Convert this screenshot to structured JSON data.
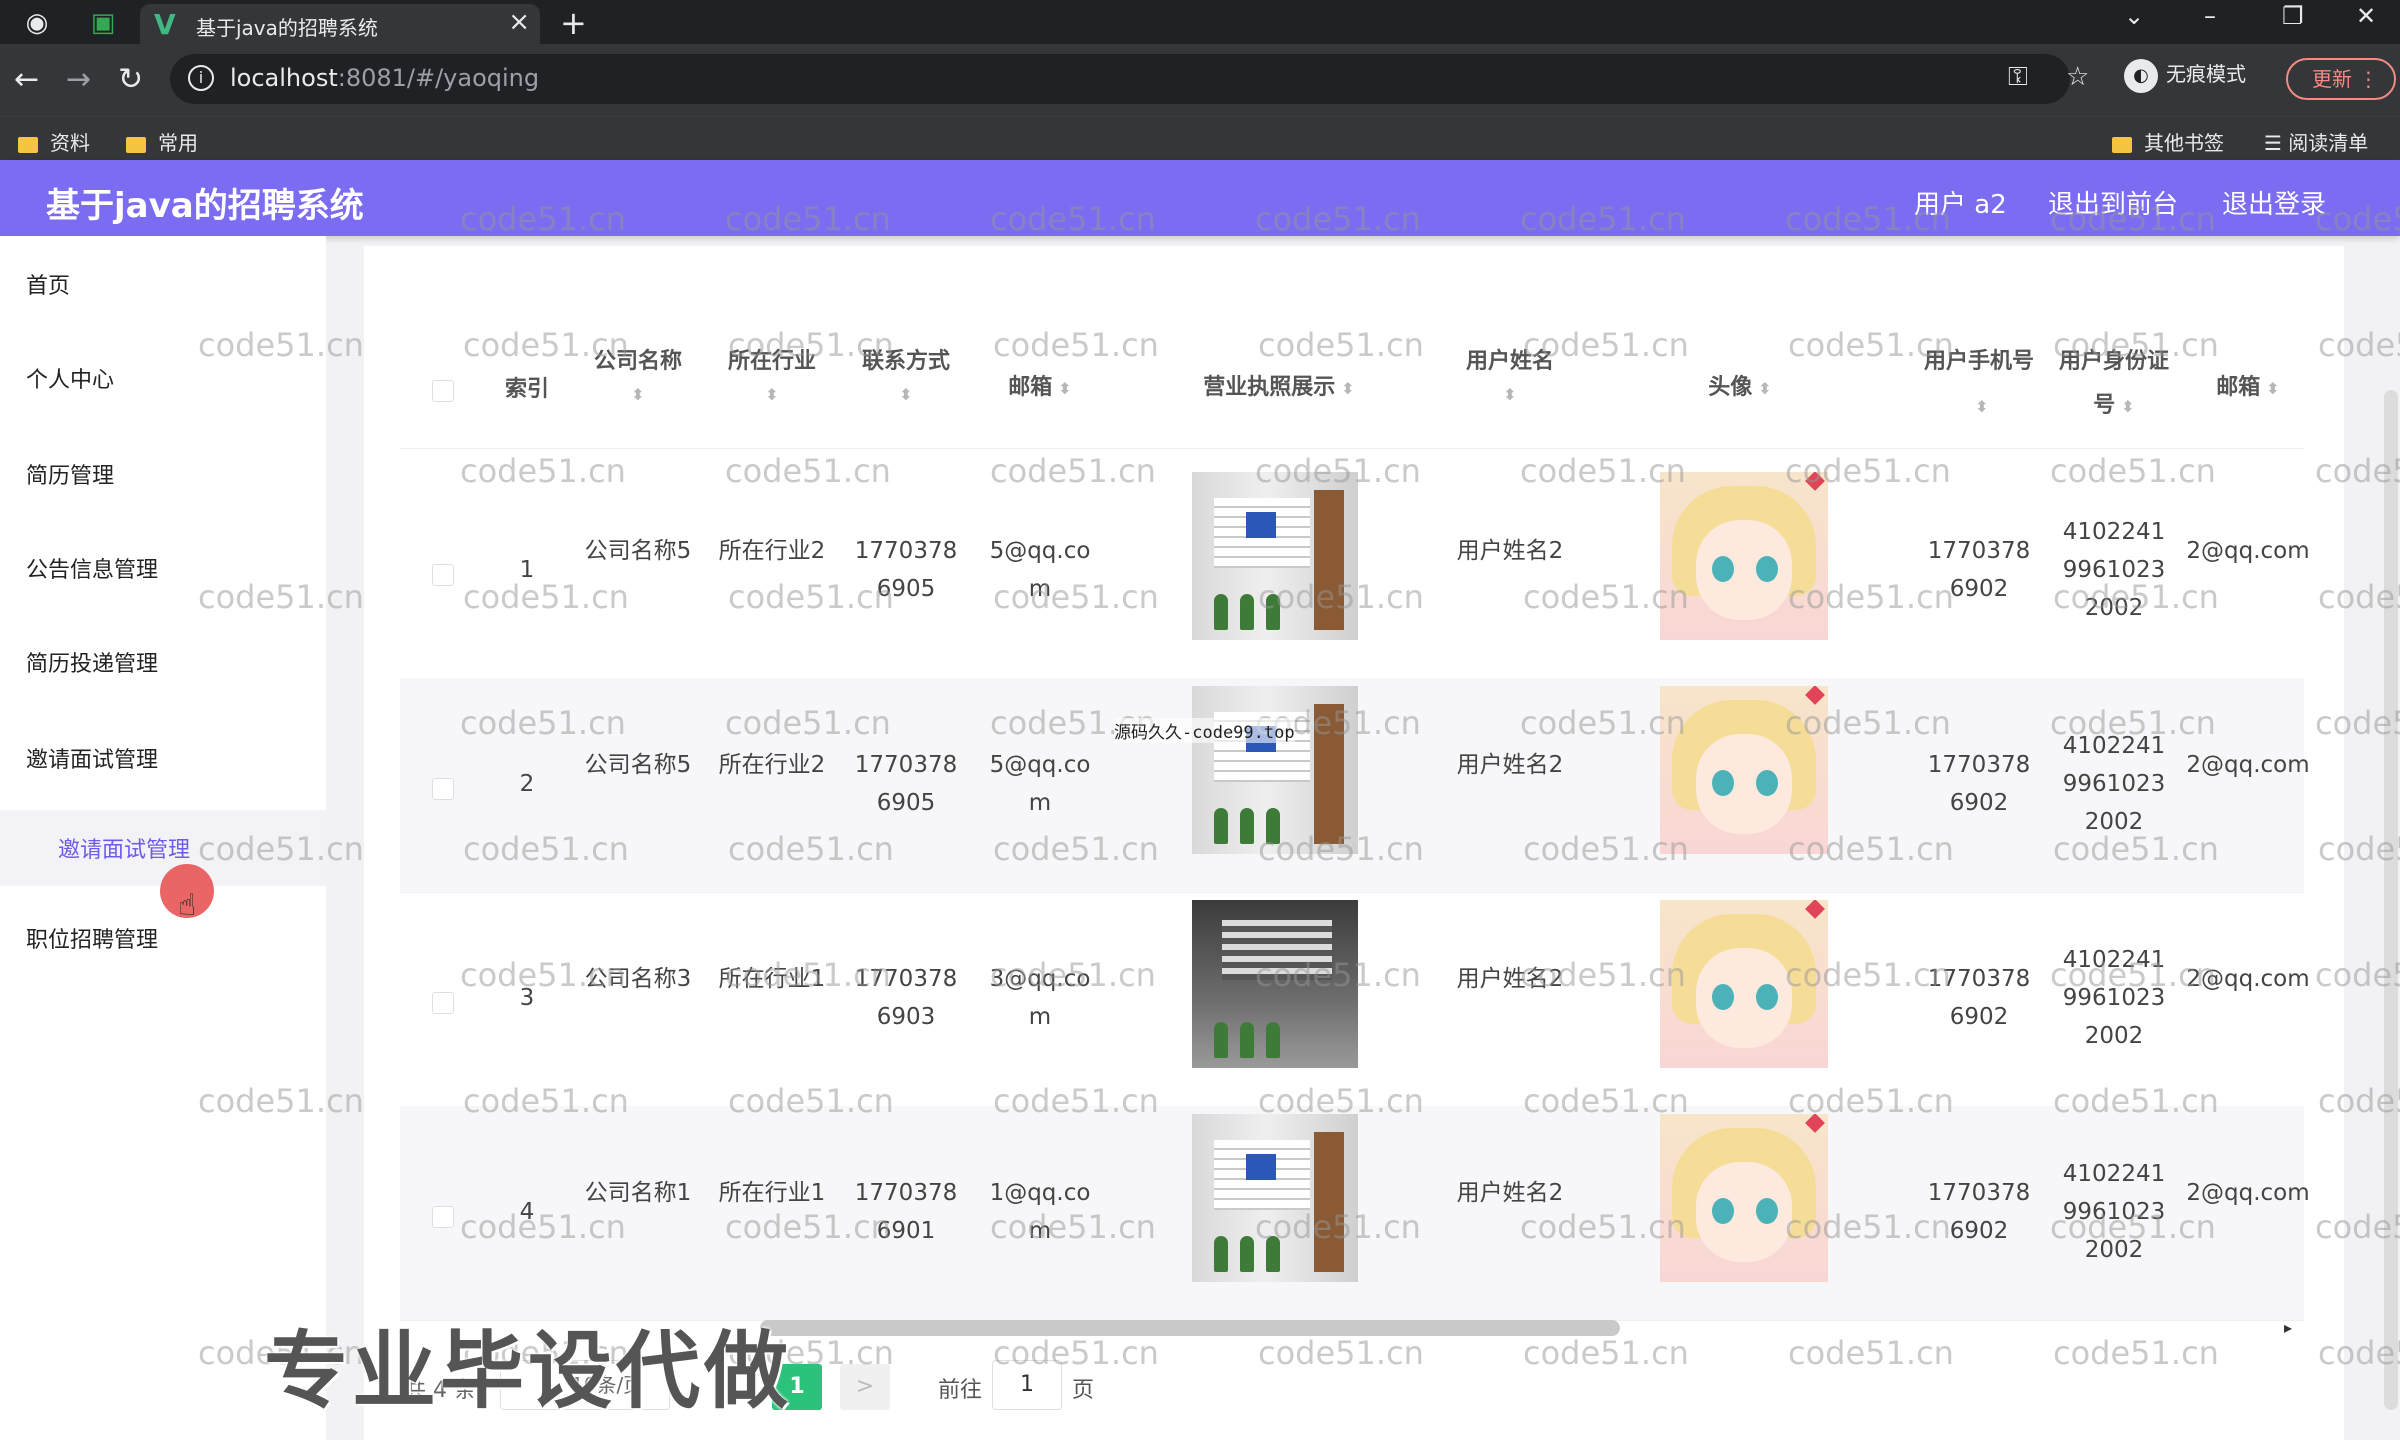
{
  "browser": {
    "tab_title": "基于java的招聘系统",
    "new_tab": "+",
    "url_host": "localhost",
    "url_rest": ":8081/#/yaoqing",
    "profile_label": "无痕模式",
    "update_label": "更新",
    "bookmarks": [
      "资料",
      "常用"
    ],
    "bookmarks_right": [
      "其他书签",
      "阅读清单"
    ]
  },
  "header": {
    "title": "基于java的招聘系统",
    "user": "用户 a2",
    "to_front": "退出到前台",
    "logout": "退出登录"
  },
  "sidebar": {
    "items": [
      "首页",
      "个人中心",
      "简历管理",
      "公告信息管理",
      "简历投递管理",
      "邀请面试管理",
      "职位招聘管理"
    ],
    "active_sub": "邀请面试管理"
  },
  "table": {
    "headers": {
      "index": "索引",
      "company": "公司名称",
      "industry": "所在行业",
      "contact": "联系方式",
      "email": "邮箱",
      "license": "营业执照展示",
      "username": "用户姓名",
      "avatar": "头像",
      "phone": "用户手机号",
      "idcard": "用户身份证号",
      "user_email": "邮箱"
    },
    "rows": [
      {
        "index": "1",
        "company": "公司名称5",
        "industry": "所在行业2",
        "contact": "17703786905",
        "email": "5@qq.com",
        "username": "用户姓名2",
        "phone": "17703786902",
        "idcard": "410224199610232002",
        "user_email": "2@qq.com"
      },
      {
        "index": "2",
        "company": "公司名称5",
        "industry": "所在行业2",
        "contact": "17703786905",
        "email": "5@qq.com",
        "username": "用户姓名2",
        "phone": "17703786902",
        "idcard": "410224199610232002",
        "user_email": "2@qq.com"
      },
      {
        "index": "3",
        "company": "公司名称3",
        "industry": "所在行业1",
        "contact": "17703786903",
        "email": "3@qq.com",
        "username": "用户姓名2",
        "phone": "17703786902",
        "idcard": "410224199610232002",
        "user_email": "2@qq.com"
      },
      {
        "index": "4",
        "company": "公司名称1",
        "industry": "所在行业1",
        "contact": "17703786901",
        "email": "1@qq.com",
        "username": "用户姓名2",
        "phone": "17703786902",
        "idcard": "410224199610232002",
        "user_email": "2@qq.com"
      }
    ]
  },
  "pagination": {
    "total": "共 4 条",
    "page_size": "10条/页",
    "current_page": "1",
    "next": ">",
    "goto_label": "前往",
    "goto_value": "1",
    "goto_suffix": "页"
  },
  "overlays": {
    "watermark": "code51.cn",
    "promo": "专业毕设代做",
    "source": "源码久久-code99.top"
  },
  "colors": {
    "header_bg": "#7b6cf2",
    "accent": "#6c5ce7",
    "page_active": "#2bc37b"
  }
}
